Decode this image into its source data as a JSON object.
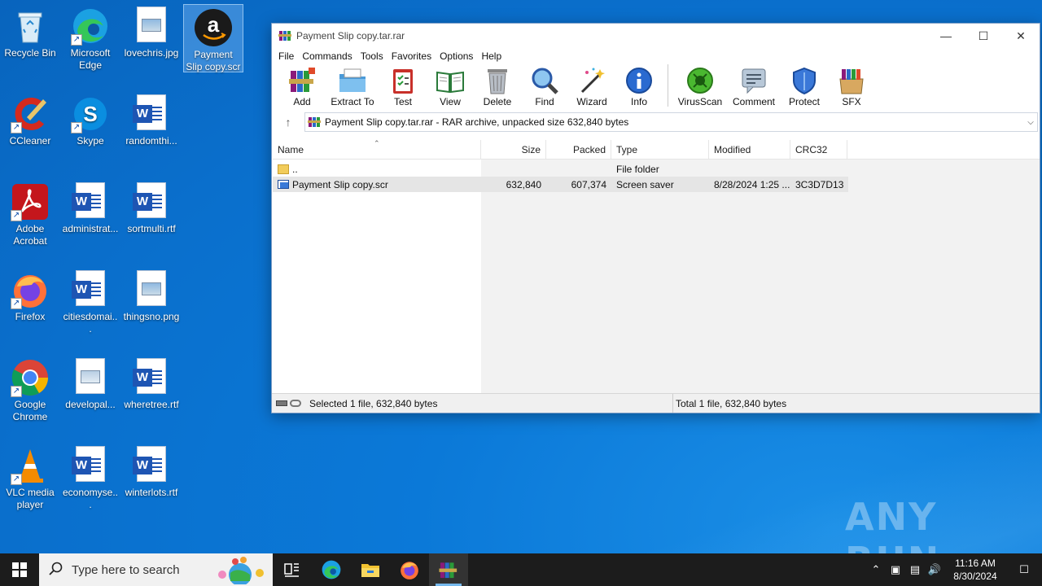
{
  "desktop": {
    "icons": [
      {
        "label": "Recycle Bin"
      },
      {
        "label": "Microsoft Edge"
      },
      {
        "label": "lovechris.jpg"
      },
      {
        "label": "Payment Slip copy.scr"
      },
      {
        "label": "CCleaner"
      },
      {
        "label": "Skype"
      },
      {
        "label": "randomthi..."
      },
      {
        "label": "Adobe Acrobat"
      },
      {
        "label": "administrat..."
      },
      {
        "label": "sortmulti.rtf"
      },
      {
        "label": "Firefox"
      },
      {
        "label": "citiesdomai..."
      },
      {
        "label": "thingsno.png"
      },
      {
        "label": "Google Chrome"
      },
      {
        "label": "developal..."
      },
      {
        "label": "wheretree.rtf"
      },
      {
        "label": "VLC media player"
      },
      {
        "label": "economyse..."
      },
      {
        "label": "winterlots.rtf"
      }
    ],
    "watermark": "ANY RUN"
  },
  "window": {
    "title": "Payment Slip copy.tar.rar",
    "controls": {
      "minimize": "—",
      "maximize": "☐",
      "close": "✕"
    },
    "menu": [
      "File",
      "Commands",
      "Tools",
      "Favorites",
      "Options",
      "Help"
    ],
    "toolbar": [
      "Add",
      "Extract To",
      "Test",
      "View",
      "Delete",
      "Find",
      "Wizard",
      "Info",
      "VirusScan",
      "Comment",
      "Protect",
      "SFX"
    ],
    "address": "Payment Slip copy.tar.rar - RAR archive, unpacked size 632,840 bytes",
    "columns": [
      "Name",
      "Size",
      "Packed",
      "Type",
      "Modified",
      "CRC32"
    ],
    "rows": [
      {
        "name": "..",
        "size": "",
        "packed": "",
        "type": "File folder",
        "modified": "",
        "crc": ""
      },
      {
        "name": "Payment Slip copy.scr",
        "size": "632,840",
        "packed": "607,374",
        "type": "Screen saver",
        "modified": "8/28/2024 1:25 ...",
        "crc": "3C3D7D13"
      }
    ],
    "status_left": "Selected 1 file, 632,840 bytes",
    "status_right": "Total 1 file, 632,840 bytes"
  },
  "taskbar": {
    "search_placeholder": "Type here to search",
    "time": "11:16 AM",
    "date": "8/30/2024"
  },
  "colors": {
    "desktop": "#0a78d7",
    "taskbar": "#1c1c1c",
    "selection": "#e5e5e5"
  }
}
